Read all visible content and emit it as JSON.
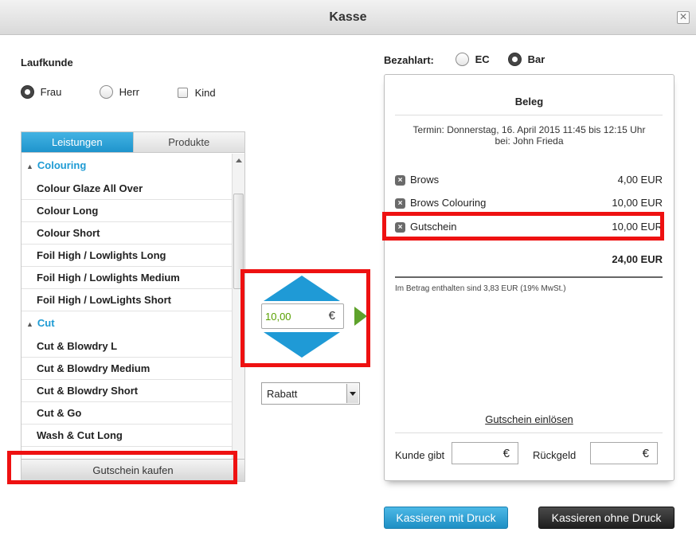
{
  "window": {
    "title": "Kasse"
  },
  "customer": {
    "heading": "Laufkunde",
    "options": [
      {
        "label": "Frau",
        "selected": true
      },
      {
        "label": "Herr",
        "selected": false
      },
      {
        "label": "Kind",
        "selected": false
      }
    ]
  },
  "tabs": {
    "services": "Leistungen",
    "products": "Produkte",
    "active": "Leistungen"
  },
  "list": {
    "categories": [
      {
        "name": "Colouring",
        "items": [
          "Colour Glaze All Over",
          "Colour Long",
          "Colour Short",
          "Foil High / Lowlights Long",
          "Foil High / Lowlights Medium",
          "Foil High / LowLights Short"
        ]
      },
      {
        "name": "Cut",
        "items": [
          "Cut & Blowdry L",
          "Cut & Blowdry Medium",
          "Cut & Blowdry Short",
          "Cut & Go",
          "Wash & Cut Long"
        ]
      }
    ],
    "bottom_button": "Gutschein kaufen"
  },
  "amount": {
    "value": "10,00",
    "currency": "€"
  },
  "discount_select": {
    "value": "Rabatt"
  },
  "payment": {
    "label": "Bezahlart:",
    "options": [
      {
        "label": "EC",
        "selected": false
      },
      {
        "label": "Bar",
        "selected": true
      }
    ]
  },
  "receipt": {
    "title": "Beleg",
    "appointment_line1": "Termin: Donnerstag, 16. April 2015 11:45 bis 12:15 Uhr",
    "appointment_line2": "bei: John Frieda",
    "lines": [
      {
        "name": "Brows",
        "price": "4,00 EUR"
      },
      {
        "name": "Brows Colouring",
        "price": "10,00 EUR"
      },
      {
        "name": "Gutschein",
        "price": "10,00 EUR"
      }
    ],
    "total": "24,00 EUR",
    "tax_note": "Im Betrag enthalten sind 3,83 EUR (19% MwSt.)",
    "redeem_link": "Gutschein einlösen",
    "customer_gives_label": "Kunde gibt",
    "change_label": "Rückgeld",
    "currency": "€"
  },
  "actions": {
    "checkout_print": "Kassieren mit Druck",
    "checkout_no_print": "Kassieren ohne Druck"
  },
  "colors": {
    "accent_blue": "#1e9bd4",
    "highlight_red": "#ee1111",
    "arrow_green": "#5ea22b",
    "amount_green": "#58a000"
  }
}
